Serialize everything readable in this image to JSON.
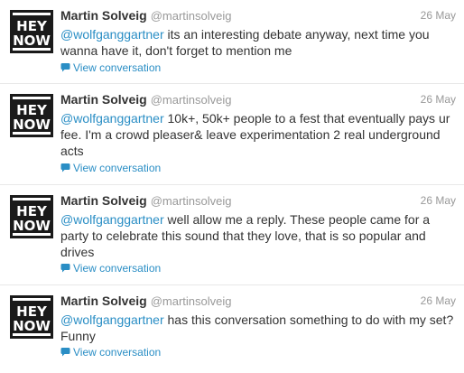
{
  "avatar": {
    "text_top": "HEY",
    "text_bottom": "NOW",
    "colors": {
      "ink": "#1a1a1a",
      "paper": "#ffffff"
    }
  },
  "colors": {
    "link": "#2a8ec5",
    "muted": "#999999",
    "text": "#333333",
    "divider": "#e8e8e8"
  },
  "tweets": [
    {
      "name": "Martin Solveig",
      "handle": "@martinsolveig",
      "date": "26 May",
      "mention": "@wolfganggartner",
      "text": " its an interesting debate anyway, next time you wanna have it, don't forget to mention me",
      "view_conversation": "View conversation"
    },
    {
      "name": "Martin Solveig",
      "handle": "@martinsolveig",
      "date": "26 May",
      "mention": "@wolfganggartner",
      "text": " 10k+, 50k+ people to a fest that eventually pays ur fee. I'm a crowd pleaser& leave experimentation 2 real underground acts",
      "view_conversation": "View conversation"
    },
    {
      "name": "Martin Solveig",
      "handle": "@martinsolveig",
      "date": "26 May",
      "mention": "@wolfganggartner",
      "text": " well allow me a reply. These people came for a party to celebrate this sound that they love, that is so popular and drives",
      "view_conversation": "View conversation"
    },
    {
      "name": "Martin Solveig",
      "handle": "@martinsolveig",
      "date": "26 May",
      "mention": "@wolfganggartner",
      "text": " has this conversation something to do with my set? Funny",
      "view_conversation": "View conversation"
    }
  ]
}
